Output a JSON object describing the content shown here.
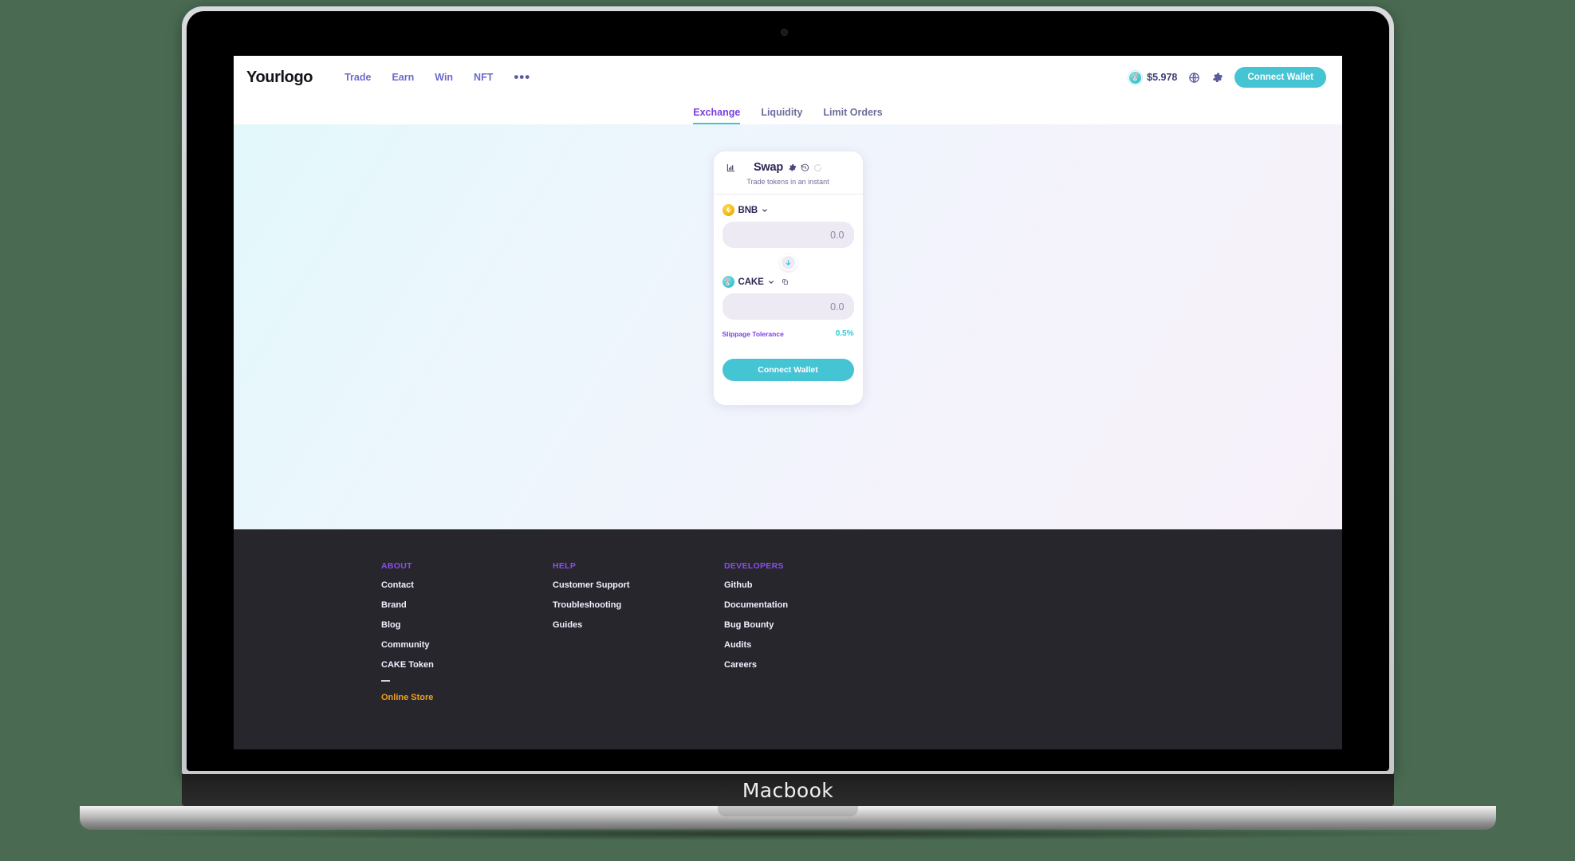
{
  "device": {
    "label": "Macbook"
  },
  "header": {
    "logo": "Yourlogo",
    "nav": [
      {
        "label": "Trade"
      },
      {
        "label": "Earn"
      },
      {
        "label": "Win"
      },
      {
        "label": "NFT"
      }
    ],
    "more_label": "•••",
    "price": {
      "value": "$5.978",
      "token_glyph": "🐰"
    },
    "globe_icon": "globe-icon",
    "settings_icon": "gear-icon",
    "connect_wallet": "Connect Wallet"
  },
  "tabs": [
    {
      "label": "Exchange",
      "active": true
    },
    {
      "label": "Liquidity",
      "active": false
    },
    {
      "label": "Limit Orders",
      "active": false
    }
  ],
  "swap": {
    "title": "Swap",
    "subtitle": "Trade tokens in an instant",
    "from": {
      "token": "BNB",
      "amount_value": "0.0",
      "amount_placeholder": "0.0"
    },
    "to": {
      "token": "CAKE",
      "amount_value": "0.0",
      "amount_placeholder": "0.0"
    },
    "slippage_label": "Slippage Tolerance",
    "slippage_value": "0.5%",
    "cta": "Connect Wallet"
  },
  "footer": {
    "columns": [
      {
        "heading": "ABOUT",
        "links": [
          "Contact",
          "Brand",
          "Blog",
          "Community",
          "CAKE Token"
        ],
        "divider": true,
        "highlight_link": "Online Store"
      },
      {
        "heading": "HELP",
        "links": [
          "Customer Support",
          "Troubleshooting",
          "Guides"
        ],
        "divider": false,
        "highlight_link": null
      },
      {
        "heading": "DEVELOPERS",
        "links": [
          "Github",
          "Documentation",
          "Bug Bounty",
          "Audits",
          "Careers"
        ],
        "divider": false,
        "highlight_link": null
      }
    ]
  },
  "colors": {
    "accent_teal": "#45c4d4",
    "accent_purple": "#7b3fe4",
    "footer_bg": "#27262c",
    "link_purple": "#6b6acb",
    "highlight_orange": "#f0a11e"
  }
}
